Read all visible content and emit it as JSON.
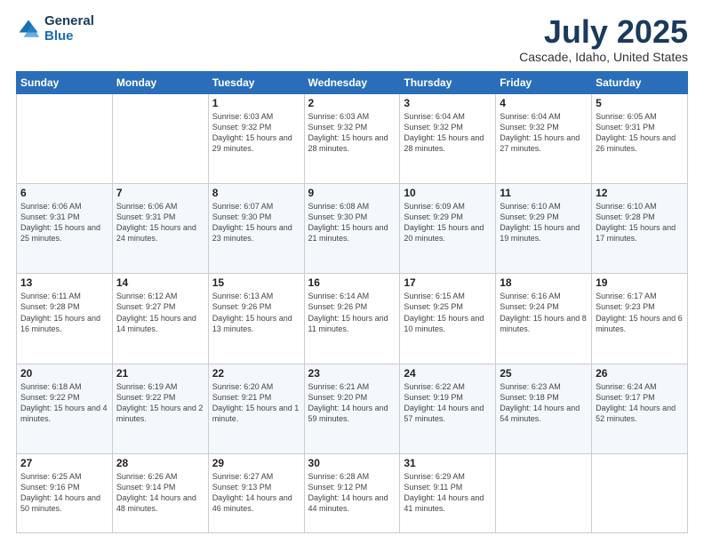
{
  "logo": {
    "line1": "General",
    "line2": "Blue"
  },
  "title": "July 2025",
  "subtitle": "Cascade, Idaho, United States",
  "header_days": [
    "Sunday",
    "Monday",
    "Tuesday",
    "Wednesday",
    "Thursday",
    "Friday",
    "Saturday"
  ],
  "weeks": [
    [
      {
        "day": "",
        "info": ""
      },
      {
        "day": "",
        "info": ""
      },
      {
        "day": "1",
        "info": "Sunrise: 6:03 AM\nSunset: 9:32 PM\nDaylight: 15 hours and 29 minutes."
      },
      {
        "day": "2",
        "info": "Sunrise: 6:03 AM\nSunset: 9:32 PM\nDaylight: 15 hours and 28 minutes."
      },
      {
        "day": "3",
        "info": "Sunrise: 6:04 AM\nSunset: 9:32 PM\nDaylight: 15 hours and 28 minutes."
      },
      {
        "day": "4",
        "info": "Sunrise: 6:04 AM\nSunset: 9:32 PM\nDaylight: 15 hours and 27 minutes."
      },
      {
        "day": "5",
        "info": "Sunrise: 6:05 AM\nSunset: 9:31 PM\nDaylight: 15 hours and 26 minutes."
      }
    ],
    [
      {
        "day": "6",
        "info": "Sunrise: 6:06 AM\nSunset: 9:31 PM\nDaylight: 15 hours and 25 minutes."
      },
      {
        "day": "7",
        "info": "Sunrise: 6:06 AM\nSunset: 9:31 PM\nDaylight: 15 hours and 24 minutes."
      },
      {
        "day": "8",
        "info": "Sunrise: 6:07 AM\nSunset: 9:30 PM\nDaylight: 15 hours and 23 minutes."
      },
      {
        "day": "9",
        "info": "Sunrise: 6:08 AM\nSunset: 9:30 PM\nDaylight: 15 hours and 21 minutes."
      },
      {
        "day": "10",
        "info": "Sunrise: 6:09 AM\nSunset: 9:29 PM\nDaylight: 15 hours and 20 minutes."
      },
      {
        "day": "11",
        "info": "Sunrise: 6:10 AM\nSunset: 9:29 PM\nDaylight: 15 hours and 19 minutes."
      },
      {
        "day": "12",
        "info": "Sunrise: 6:10 AM\nSunset: 9:28 PM\nDaylight: 15 hours and 17 minutes."
      }
    ],
    [
      {
        "day": "13",
        "info": "Sunrise: 6:11 AM\nSunset: 9:28 PM\nDaylight: 15 hours and 16 minutes."
      },
      {
        "day": "14",
        "info": "Sunrise: 6:12 AM\nSunset: 9:27 PM\nDaylight: 15 hours and 14 minutes."
      },
      {
        "day": "15",
        "info": "Sunrise: 6:13 AM\nSunset: 9:26 PM\nDaylight: 15 hours and 13 minutes."
      },
      {
        "day": "16",
        "info": "Sunrise: 6:14 AM\nSunset: 9:26 PM\nDaylight: 15 hours and 11 minutes."
      },
      {
        "day": "17",
        "info": "Sunrise: 6:15 AM\nSunset: 9:25 PM\nDaylight: 15 hours and 10 minutes."
      },
      {
        "day": "18",
        "info": "Sunrise: 6:16 AM\nSunset: 9:24 PM\nDaylight: 15 hours and 8 minutes."
      },
      {
        "day": "19",
        "info": "Sunrise: 6:17 AM\nSunset: 9:23 PM\nDaylight: 15 hours and 6 minutes."
      }
    ],
    [
      {
        "day": "20",
        "info": "Sunrise: 6:18 AM\nSunset: 9:22 PM\nDaylight: 15 hours and 4 minutes."
      },
      {
        "day": "21",
        "info": "Sunrise: 6:19 AM\nSunset: 9:22 PM\nDaylight: 15 hours and 2 minutes."
      },
      {
        "day": "22",
        "info": "Sunrise: 6:20 AM\nSunset: 9:21 PM\nDaylight: 15 hours and 1 minute."
      },
      {
        "day": "23",
        "info": "Sunrise: 6:21 AM\nSunset: 9:20 PM\nDaylight: 14 hours and 59 minutes."
      },
      {
        "day": "24",
        "info": "Sunrise: 6:22 AM\nSunset: 9:19 PM\nDaylight: 14 hours and 57 minutes."
      },
      {
        "day": "25",
        "info": "Sunrise: 6:23 AM\nSunset: 9:18 PM\nDaylight: 14 hours and 54 minutes."
      },
      {
        "day": "26",
        "info": "Sunrise: 6:24 AM\nSunset: 9:17 PM\nDaylight: 14 hours and 52 minutes."
      }
    ],
    [
      {
        "day": "27",
        "info": "Sunrise: 6:25 AM\nSunset: 9:16 PM\nDaylight: 14 hours and 50 minutes."
      },
      {
        "day": "28",
        "info": "Sunrise: 6:26 AM\nSunset: 9:14 PM\nDaylight: 14 hours and 48 minutes."
      },
      {
        "day": "29",
        "info": "Sunrise: 6:27 AM\nSunset: 9:13 PM\nDaylight: 14 hours and 46 minutes."
      },
      {
        "day": "30",
        "info": "Sunrise: 6:28 AM\nSunset: 9:12 PM\nDaylight: 14 hours and 44 minutes."
      },
      {
        "day": "31",
        "info": "Sunrise: 6:29 AM\nSunset: 9:11 PM\nDaylight: 14 hours and 41 minutes."
      },
      {
        "day": "",
        "info": ""
      },
      {
        "day": "",
        "info": ""
      }
    ]
  ]
}
